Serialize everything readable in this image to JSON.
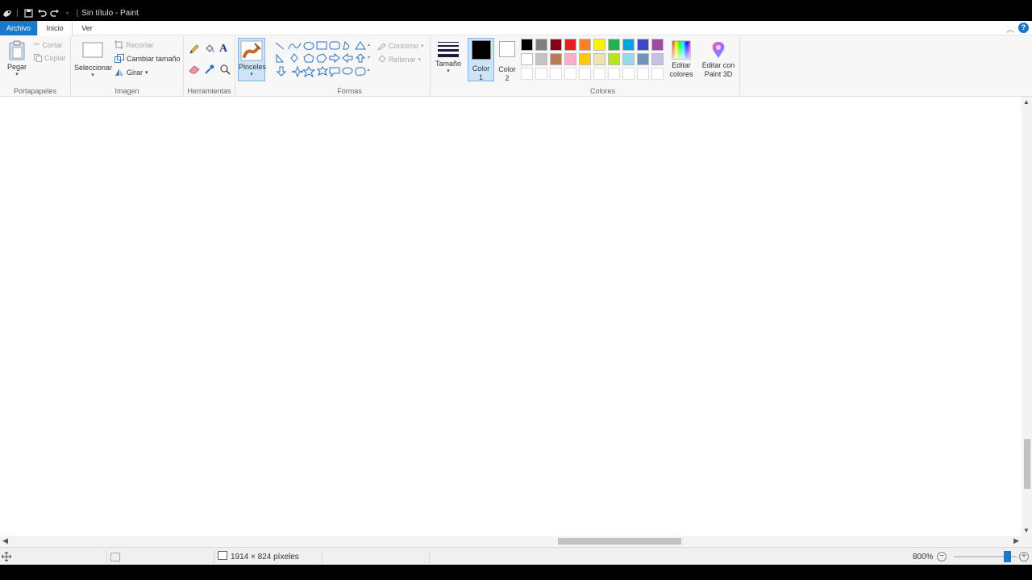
{
  "window": {
    "title": "Sin título - Paint"
  },
  "tabs": {
    "file": "Archivo",
    "home": "Inicio",
    "view": "Ver"
  },
  "clipboard": {
    "paste": "Pegar",
    "cut": "Cortar",
    "copy": "Copiar",
    "label": "Portapapeles"
  },
  "image": {
    "select": "Seleccionar",
    "crop": "Recortar",
    "resize": "Cambiar tamaño",
    "rotate": "Girar",
    "label": "Imagen"
  },
  "tools": {
    "label": "Herramientas"
  },
  "brushes": {
    "label": "Pinceles"
  },
  "shapes": {
    "outline": "Contorno",
    "fill": "Rellenar",
    "label": "Formas"
  },
  "size": {
    "label": "Tamaño"
  },
  "colors": {
    "color1": "Color 1",
    "color2": "Color 2",
    "edit_colors": "Editar colores",
    "edit_paint3d": "Editar con Paint 3D",
    "label": "Colores",
    "color1_value": "#000000",
    "color2_value": "#ffffff",
    "palette_row1": [
      "#000000",
      "#7f7f7f",
      "#880015",
      "#ed1c24",
      "#ff7f27",
      "#fff200",
      "#22b14c",
      "#00a2e8",
      "#3f48cc",
      "#a349a4"
    ],
    "palette_row2": [
      "#ffffff",
      "#c3c3c3",
      "#b97a57",
      "#ffaec9",
      "#ffc90e",
      "#efe4b0",
      "#b5e61d",
      "#99d9ea",
      "#7092be",
      "#c8bfe7"
    ]
  },
  "status": {
    "dimensions": "1914 × 824 píxeles",
    "zoom": "800%"
  }
}
